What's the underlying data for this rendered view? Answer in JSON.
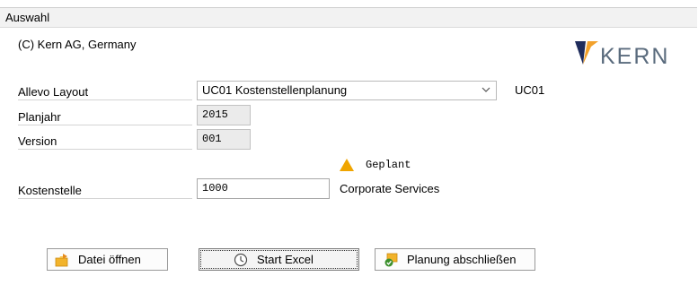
{
  "group": {
    "title": "Auswahl"
  },
  "copyright": "(C) Kern AG, Germany",
  "logo": {
    "text": "KERN"
  },
  "form": {
    "layout": {
      "label": "Allevo Layout",
      "value": "UC01 Kostenstellenplanung",
      "code": "UC01"
    },
    "planjahr": {
      "label": "Planjahr",
      "value": "2015"
    },
    "version": {
      "label": "Version",
      "value": "001"
    },
    "status": {
      "text": "Geplant",
      "icon": "warning-triangle-icon",
      "color": "#f0a500"
    },
    "kostenstelle": {
      "label": "Kostenstelle",
      "value": "1000",
      "description": "Corporate Services"
    }
  },
  "buttons": {
    "open": {
      "label": "Datei öffnen",
      "icon": "open-folder-icon"
    },
    "excel": {
      "label": "Start Excel",
      "icon": "start-clock-icon"
    },
    "finish": {
      "label": "Planung abschließen",
      "icon": "finish-planning-icon"
    }
  }
}
